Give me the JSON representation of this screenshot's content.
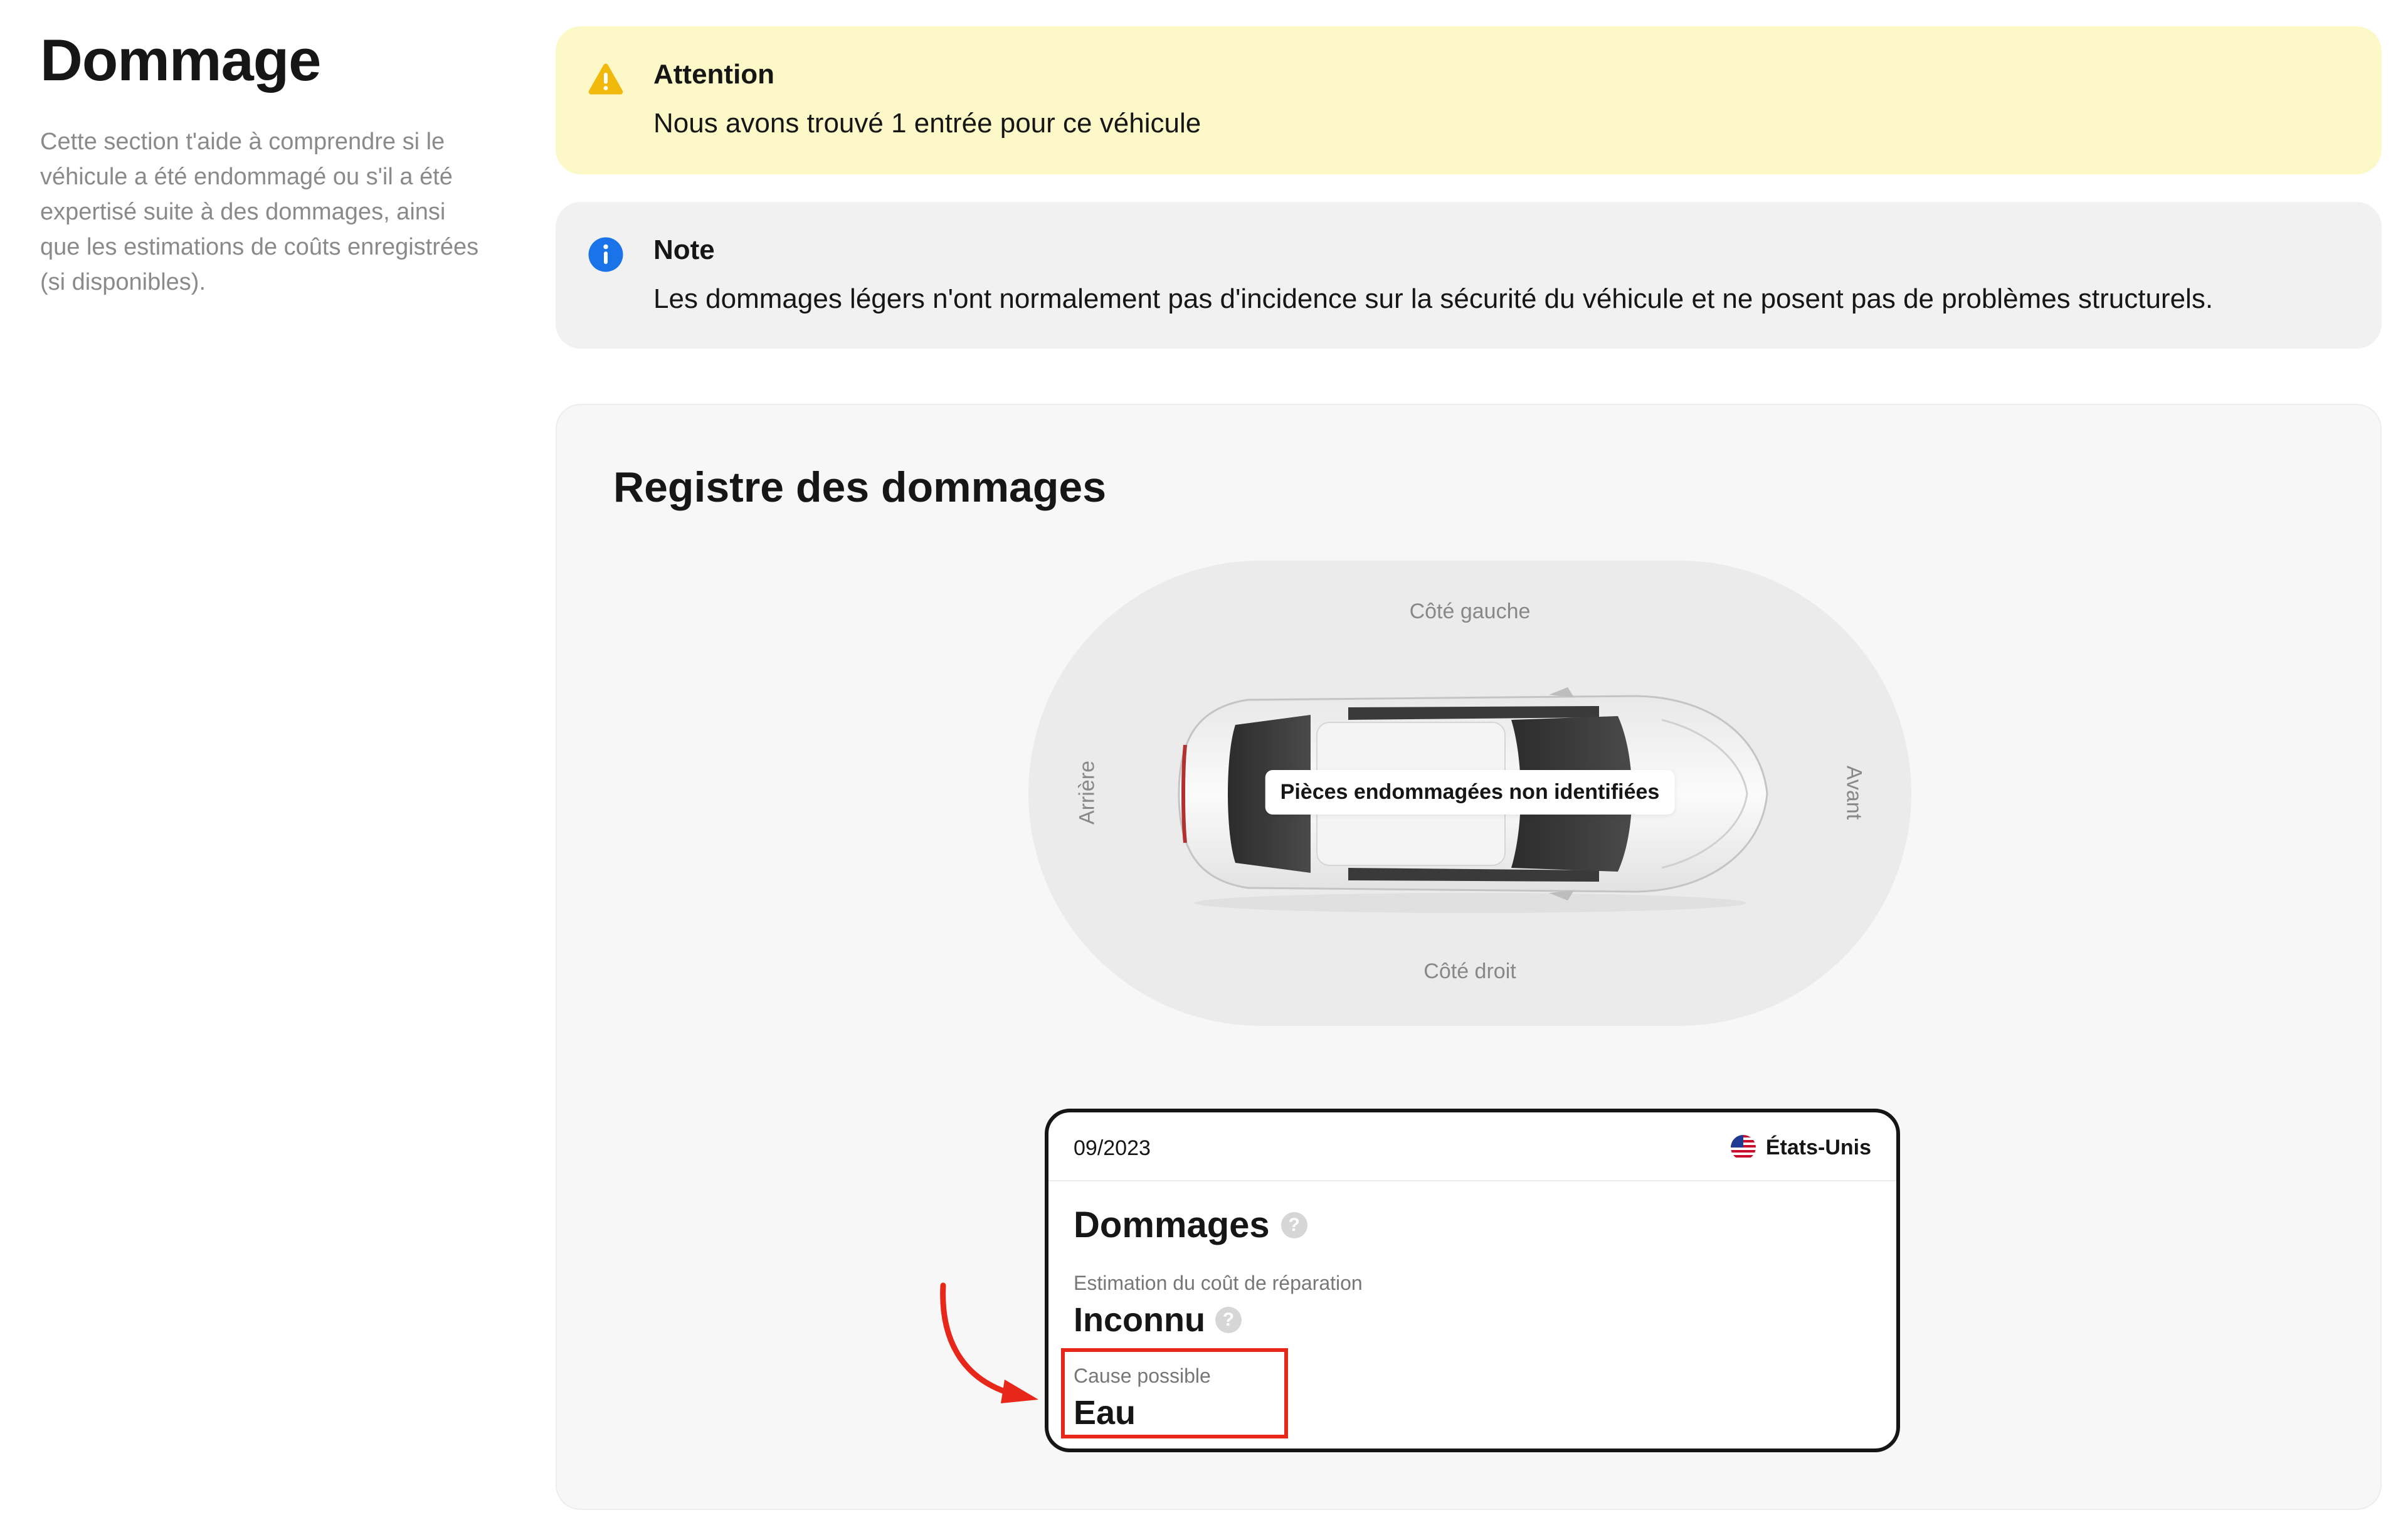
{
  "section": {
    "title": "Dommage",
    "description": "Cette section t'aide à comprendre si le véhicule a été endommagé ou s'il a été expertisé suite à des dommages, ainsi que les estimations de coûts enregistrées (si disponibles)."
  },
  "alerts": {
    "warning": {
      "icon": "warning-triangle-icon",
      "title": "Attention",
      "text": "Nous avons trouvé 1 entrée pour ce véhicule",
      "background": "#fdf8c8",
      "icon_color": "#f0b90b"
    },
    "note": {
      "icon": "info-icon",
      "title": "Note",
      "text": "Les dommages légers n'ont normalement pas d'incidence sur la sécurité du véhicule et ne posent pas de problèmes structurels.",
      "background": "#f1f1f1",
      "icon_color": "#1a73e8"
    }
  },
  "register": {
    "title": "Registre des dommages",
    "diagram": {
      "left_side": "Côté gauche",
      "right_side": "Côté droit",
      "rear": "Arrière",
      "front": "Avant",
      "tag": "Pièces endommagées non identifiées"
    },
    "record": {
      "date": "09/2023",
      "country": "États-Unis",
      "country_flag": "us-flag-icon",
      "heading": "Dommages",
      "cost_label": "Estimation du coût de réparation",
      "cost_value": "Inconnu",
      "cause_label": "Cause possible",
      "cause_value": "Eau"
    }
  },
  "annotation": {
    "color": "#e8271b"
  }
}
